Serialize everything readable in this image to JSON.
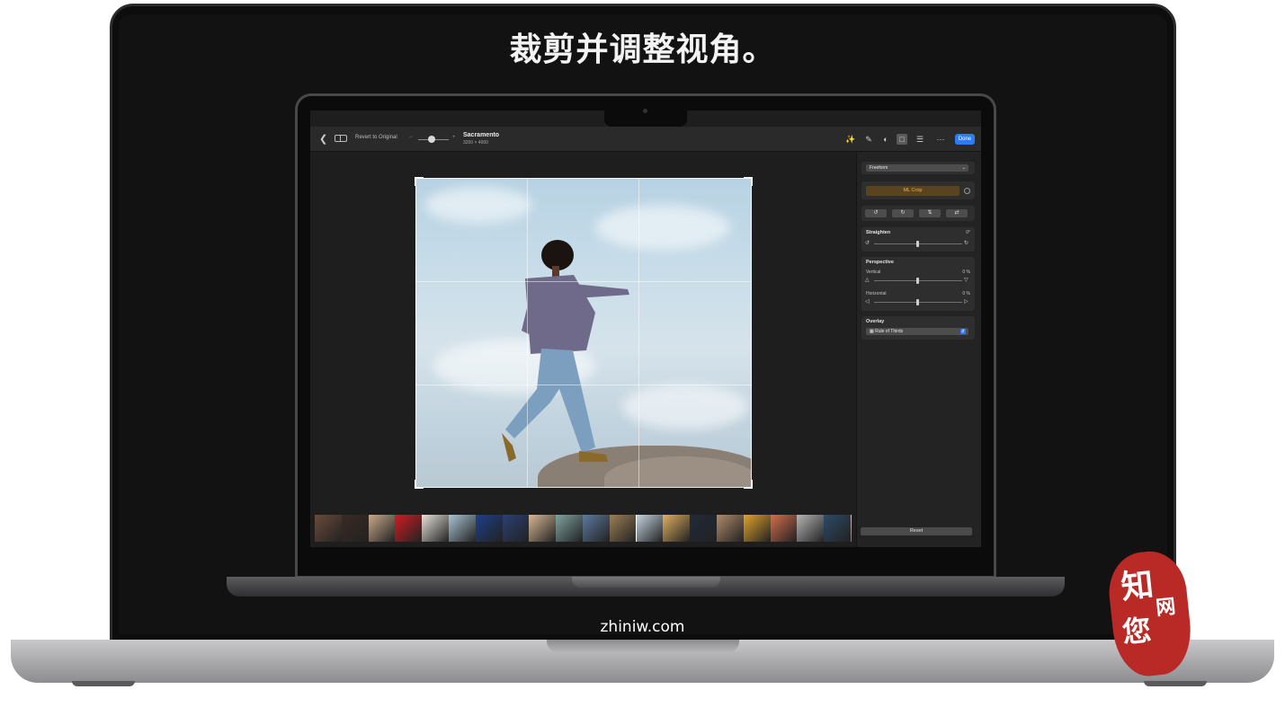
{
  "headline": "裁剪并调整视角。",
  "domain_text": "zhiniw.com",
  "app": {
    "revert_label": "Revert to Original",
    "photo_title": "Sacramento",
    "photo_dims": "3200 × 4000",
    "done_label": "Done",
    "icons": [
      "back-icon",
      "compare-icon",
      "auto-enhance-icon",
      "retouch-icon",
      "filters-icon",
      "crop-icon",
      "adjust-icon",
      "more-icon"
    ]
  },
  "sidebar": {
    "aspect_dropdown": "Freeform",
    "ml_crop_label": "ML Crop",
    "straighten": {
      "label": "Straighten",
      "value": "0°"
    },
    "perspective": {
      "label": "Perspective",
      "vertical": {
        "label": "Vertical",
        "value": "0 %"
      },
      "horizontal": {
        "label": "Horizontal",
        "value": "0 %"
      }
    },
    "overlay": {
      "label": "Overlay",
      "selected": "Rule of Thirds"
    },
    "reset_label": "Reset"
  },
  "filmstrip": {
    "thumb_colors": [
      "#6b4b3a",
      "#3a2a24",
      "#c9a98a",
      "#d11c22",
      "#e6e1da",
      "#a9c4d4",
      "#1d3f8a",
      "#2a3f73",
      "#d8b894",
      "#7fa3a0",
      "#5d7aa0",
      "#9c7e55",
      "#c3d3df",
      "#e0b060",
      "#1f2a3a",
      "#b08a6a",
      "#e0a32a",
      "#d36d4d",
      "#b5b5b5",
      "#2c4a66",
      "#e7c4c8"
    ]
  },
  "badge": {
    "chars": [
      "知",
      "网",
      "您"
    ]
  }
}
